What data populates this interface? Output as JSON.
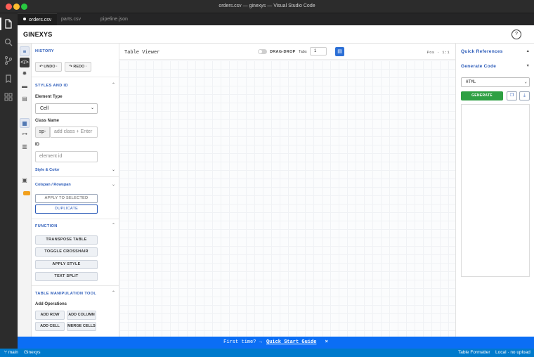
{
  "window": {
    "title": "orders.csv — ginexys — Visual Studio Code"
  },
  "activity_bar": {
    "icons": [
      "files-icon",
      "search-icon",
      "source-control-icon",
      "bookmark-icon",
      "extensions-icon"
    ]
  },
  "tabs": [
    {
      "label": "orders.csv",
      "active": true
    },
    {
      "label": "parts.csv",
      "active": false
    },
    {
      "label": "pipeline.json",
      "active": false
    }
  ],
  "app": {
    "brand": "GINEXYS",
    "help": "?"
  },
  "history": {
    "title": "HISTORY",
    "undo": "↶ UNDO ·",
    "redo": "↷ REDO ·"
  },
  "styles": {
    "title": "STYLES AND ID",
    "element_type_label": "Element Type",
    "element_type_value": "Cell",
    "class_label": "Class Name",
    "class_prefix": "sp-",
    "class_placeholder": "add class + Enter",
    "id_label": "ID",
    "id_placeholder": "element id",
    "style_color": "Style & Color",
    "colspan": "Colspan / Rowspan",
    "apply_selected": "APPLY TO SELECTED",
    "duplicate": "DUPLICATE"
  },
  "function": {
    "title": "FUNCTION",
    "buttons": [
      "TRANSPOSE TABLE",
      "TOGGLE CROSSHAIR",
      "APPLY STYLE",
      "TEXT SPLIT"
    ]
  },
  "table_manip": {
    "title": "TABLE MANIPULATION TOOL",
    "add_ops_label": "Add Operations",
    "buttons": [
      "ADD ROW",
      "ADD COLUMN",
      "ADD CELL",
      "MERGE CELLS"
    ]
  },
  "center": {
    "title": "Table Viewer",
    "drag_drop": "DRAG-DROP",
    "tabs_label": "Tabs",
    "tabs_value": "1",
    "pos": "Pos · 1:1"
  },
  "right": {
    "quick_refs": "Quick References",
    "generate_code": "Generate Code",
    "format": "HTML",
    "generate": "GENERATE"
  },
  "banner": {
    "text": "First time? →",
    "link": "Quick Start Guide",
    "close": "×"
  },
  "status": {
    "branch": "main",
    "app": "Ginexys",
    "right1": "Table Formatter",
    "right2": "Local · no upload"
  }
}
